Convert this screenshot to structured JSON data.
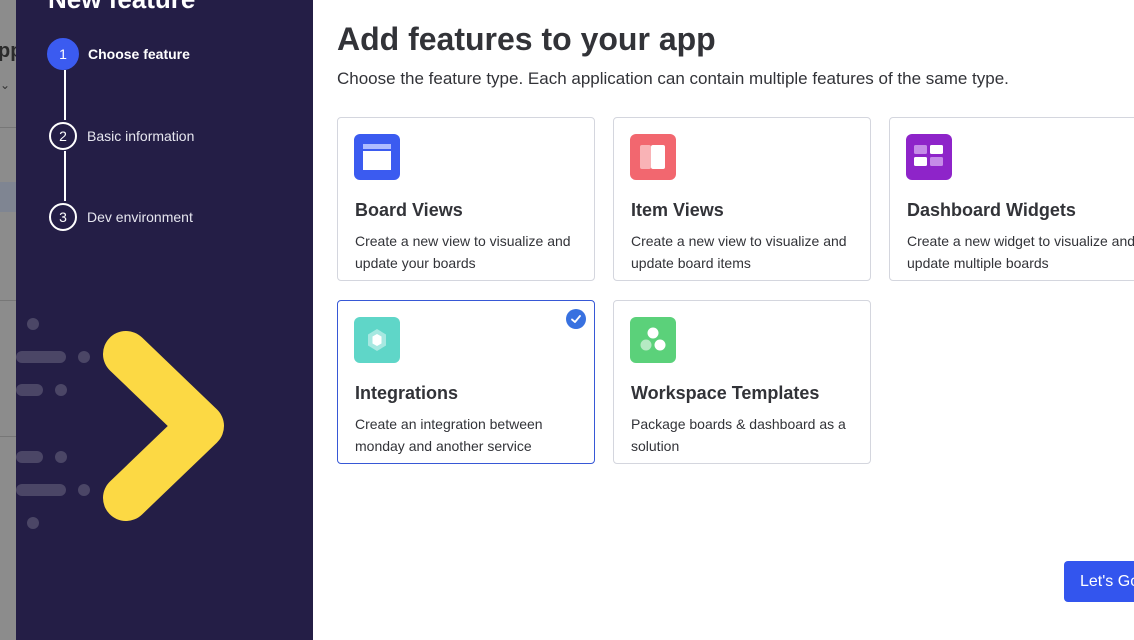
{
  "background_app": {
    "partial_title": "pp"
  },
  "sidebar": {
    "title": "New feature",
    "steps": [
      {
        "number": "1",
        "label": "Choose feature",
        "active": true
      },
      {
        "number": "2",
        "label": "Basic information",
        "active": false
      },
      {
        "number": "3",
        "label": "Dev environment",
        "active": false
      }
    ]
  },
  "main": {
    "title": "Add features to your app",
    "subtitle": "Choose the feature type. Each application can contain multiple features of the same type.",
    "cards": [
      {
        "title": "Board Views",
        "description": "Create a new view to visualize and update your boards",
        "icon": "board-view-icon",
        "color": "#3b5bf0",
        "selected": false
      },
      {
        "title": "Item Views",
        "description": "Create a new view to visualize and update board items",
        "icon": "item-view-icon",
        "color": "#f2676f",
        "selected": false
      },
      {
        "title": "Dashboard Widgets",
        "description": "Create a new widget to visualize and update multiple boards",
        "icon": "dashboard-widget-icon",
        "color": "#8e24c9",
        "selected": false
      },
      {
        "title": "Integrations",
        "description": "Create an integration between monday and another service",
        "icon": "integration-icon",
        "color": "#5fd6c8",
        "selected": true
      },
      {
        "title": "Workspace Templates",
        "description": "Package boards & dashboard as a solution",
        "icon": "workspace-template-icon",
        "color": "#5bd17a",
        "selected": false
      }
    ],
    "primary_button": "Let's Go"
  },
  "colors": {
    "sidebar_bg": "#241e46",
    "accent": "#3355ee",
    "decor_yellow": "#fcd944"
  }
}
